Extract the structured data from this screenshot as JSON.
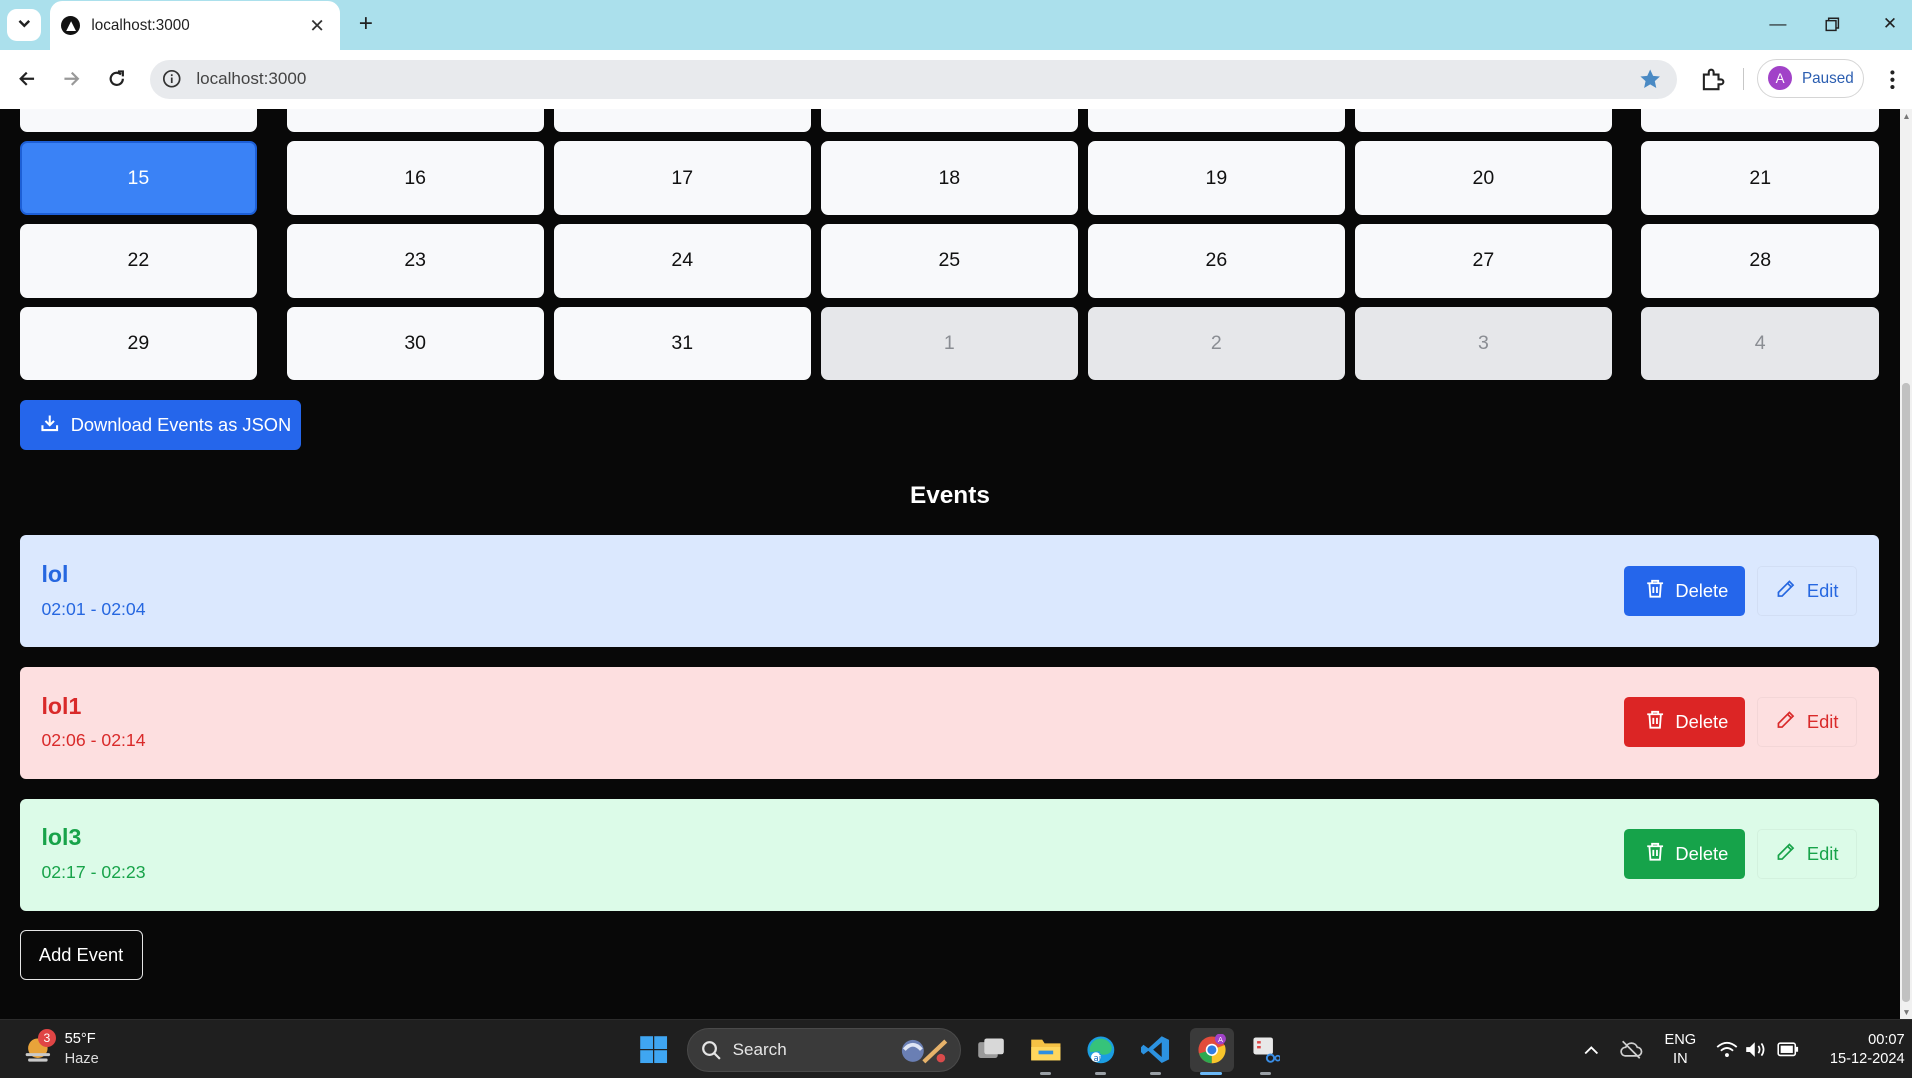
{
  "browser": {
    "tab_title": "localhost:3000",
    "url": "localhost:3000",
    "profile_initial": "A",
    "profile_status": "Paused"
  },
  "calendar": {
    "partial_row": [
      "",
      "",
      "",
      "",
      "",
      "",
      ""
    ],
    "weeks": [
      [
        {
          "day": "15",
          "state": "selected"
        },
        {
          "day": "16",
          "state": "normal"
        },
        {
          "day": "17",
          "state": "normal"
        },
        {
          "day": "18",
          "state": "normal"
        },
        {
          "day": "19",
          "state": "normal"
        },
        {
          "day": "20",
          "state": "normal"
        },
        {
          "day": "21",
          "state": "normal"
        }
      ],
      [
        {
          "day": "22",
          "state": "normal"
        },
        {
          "day": "23",
          "state": "normal"
        },
        {
          "day": "24",
          "state": "normal"
        },
        {
          "day": "25",
          "state": "normal"
        },
        {
          "day": "26",
          "state": "normal"
        },
        {
          "day": "27",
          "state": "normal"
        },
        {
          "day": "28",
          "state": "normal"
        }
      ],
      [
        {
          "day": "29",
          "state": "normal"
        },
        {
          "day": "30",
          "state": "normal"
        },
        {
          "day": "31",
          "state": "normal"
        },
        {
          "day": "1",
          "state": "outside-month"
        },
        {
          "day": "2",
          "state": "outside-month"
        },
        {
          "day": "3",
          "state": "outside-month"
        },
        {
          "day": "4",
          "state": "outside-month"
        }
      ]
    ]
  },
  "download_button_label": "Download Events as JSON",
  "events_heading": "Events",
  "events": [
    {
      "title": "lol",
      "time": "02:01 - 02:04",
      "theme": "blue",
      "bg": "#dbe8fe",
      "text_color": "#2667e0",
      "delete_bg": "#2566eb",
      "delete_label": "Delete",
      "edit_label": "Edit"
    },
    {
      "title": "lol1",
      "time": "02:06 - 02:14",
      "theme": "red",
      "bg": "#fddfe0",
      "text_color": "#d92a2a",
      "delete_bg": "#dc2525",
      "delete_label": "Delete",
      "edit_label": "Edit"
    },
    {
      "title": "lol3",
      "time": "02:17 - 02:23",
      "theme": "green",
      "bg": "#dcfbe8",
      "text_color": "#18a34a",
      "delete_bg": "#16a34a",
      "delete_label": "Delete",
      "edit_label": "Edit"
    }
  ],
  "add_event_label": "Add Event",
  "taskbar": {
    "weather_badge": "3",
    "temperature": "55°F",
    "condition": "Haze",
    "search_label": "Search",
    "lang_top": "ENG",
    "lang_bottom": "IN",
    "time": "00:07",
    "date": "15-12-2024"
  }
}
